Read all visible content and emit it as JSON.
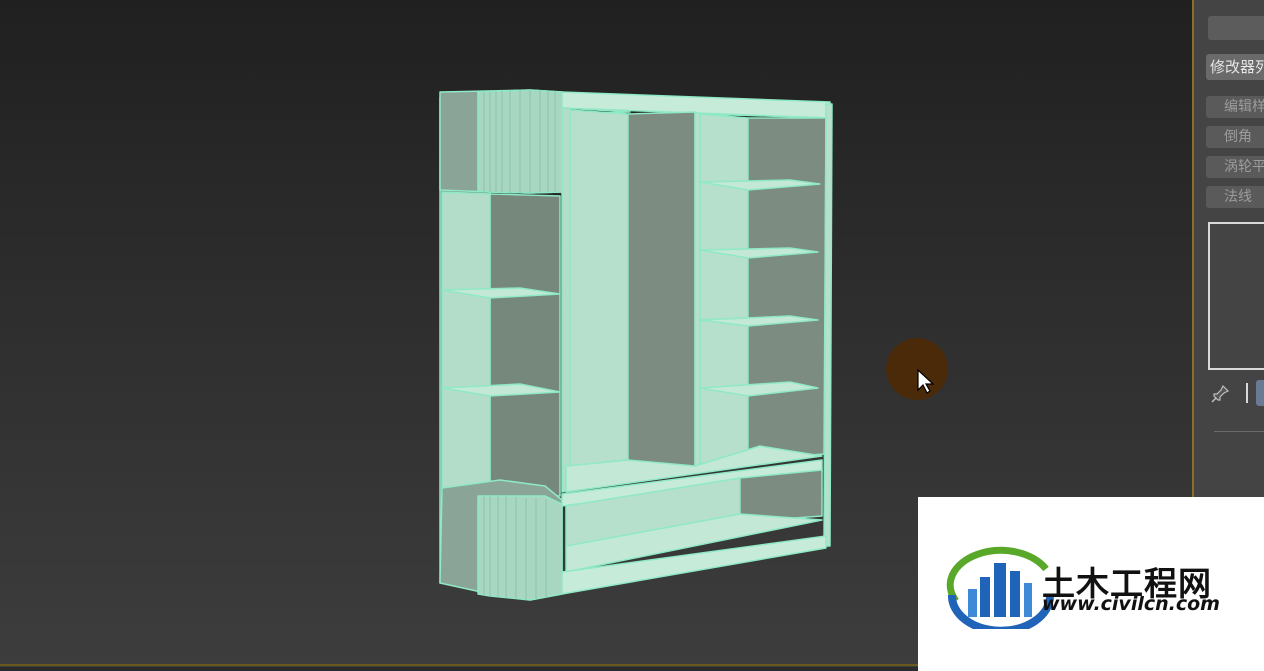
{
  "panel": {
    "modifier_list": "修改器列表",
    "buttons": [
      "编辑样条线",
      "倒角",
      "涡轮平滑",
      "法线"
    ]
  },
  "watermark": {
    "title": "土木工程网",
    "url": "www.civilcn.com"
  },
  "colors": {
    "viewport_top": "#202020",
    "viewport_bottom": "#3d3d3d",
    "model_face": "#b6e0cc",
    "model_shadow": "#7c8c80",
    "model_edge": "#8fe8c6",
    "panel_border": "#8a6f24"
  }
}
